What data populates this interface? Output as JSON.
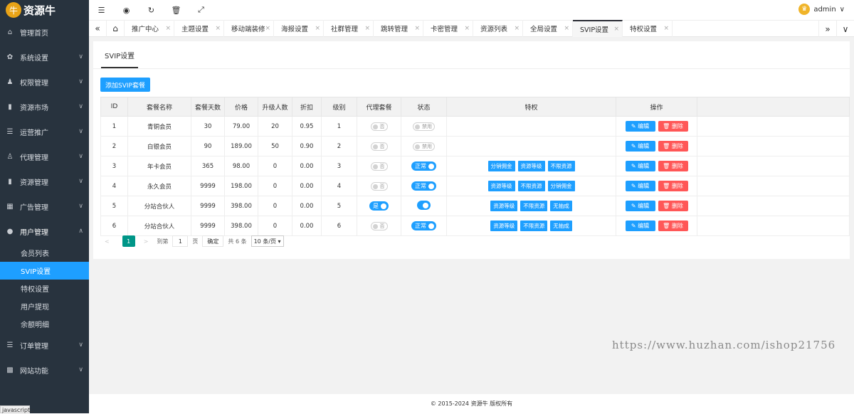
{
  "brand": {
    "logo_mark": "牛",
    "name": "资源牛"
  },
  "sidebar": {
    "items": [
      {
        "label": "管理首页",
        "icon": "home-icon",
        "glyph": "⌂",
        "chevron": ""
      },
      {
        "label": "系统设置",
        "icon": "gear-icon",
        "glyph": "✿",
        "chevron": "∨"
      },
      {
        "label": "权限管理",
        "icon": "user-key-icon",
        "glyph": "♟",
        "chevron": "∨"
      },
      {
        "label": "资源市场",
        "icon": "doc-icon",
        "glyph": "▮",
        "chevron": "∨"
      },
      {
        "label": "运营推广",
        "icon": "list-icon",
        "glyph": "☰",
        "chevron": "∨"
      },
      {
        "label": "代理管理",
        "icon": "agent-icon",
        "glyph": "♙",
        "chevron": "∨"
      },
      {
        "label": "资源管理",
        "icon": "doc-icon",
        "glyph": "▮",
        "chevron": "∨"
      },
      {
        "label": "广告管理",
        "icon": "ad-icon",
        "glyph": "▦",
        "chevron": "∨"
      },
      {
        "label": "用户管理",
        "icon": "user-icon",
        "glyph": "●",
        "chevron": "∧"
      }
    ],
    "sub_items": [
      "会员列表",
      "SVIP设置",
      "特权设置",
      "用户提现",
      "余额明细"
    ],
    "bottom_items": [
      {
        "label": "订单管理",
        "icon": "list-icon",
        "glyph": "☰",
        "chevron": "∨"
      },
      {
        "label": "网站功能",
        "icon": "grid-icon",
        "glyph": "▩",
        "chevron": "∨"
      }
    ],
    "status_tip": "javascript:;"
  },
  "topbar": {
    "icons": [
      "☰",
      "◉",
      "↻",
      "🗑",
      "⤢"
    ],
    "user": "admin",
    "user_chevron": "∨"
  },
  "tabs": {
    "prev": "«",
    "home": "⌂",
    "items": [
      "推广中心",
      "主题设置",
      "移动端装修",
      "海报设置",
      "社群管理",
      "跳转管理",
      "卡密管理",
      "资源列表",
      "全局设置",
      "SVIP设置",
      "特权设置"
    ],
    "close": "×",
    "next": "»",
    "more": "∨"
  },
  "page": {
    "tab_title": "SVIP设置",
    "add_button": "添加SVIP套餐"
  },
  "table": {
    "headers": [
      "ID",
      "套餐名称",
      "套餐天数",
      "价格",
      "升级人数",
      "折扣",
      "级别",
      "代理套餐",
      "状态",
      "特权",
      "操作"
    ],
    "edit_label": "✎ 编辑",
    "delete_label": "🗑 删除",
    "rows": [
      {
        "id": "1",
        "name": "青铜会员",
        "days": "30",
        "price": "79.00",
        "upgrade": "20",
        "discount": "0.95",
        "level": "1",
        "agent": "否",
        "status": "禁用",
        "status_on": false,
        "privileges": []
      },
      {
        "id": "2",
        "name": "白银会员",
        "days": "90",
        "price": "189.00",
        "upgrade": "50",
        "discount": "0.90",
        "level": "2",
        "agent": "否",
        "status": "禁用",
        "status_on": false,
        "privileges": []
      },
      {
        "id": "3",
        "name": "年卡会员",
        "days": "365",
        "price": "98.00",
        "upgrade": "0",
        "discount": "0.00",
        "level": "3",
        "agent": "否",
        "status": "正常",
        "status_on": true,
        "privileges": [
          "分销佣金",
          "资源等级",
          "不限资源"
        ]
      },
      {
        "id": "4",
        "name": "永久会员",
        "days": "9999",
        "price": "198.00",
        "upgrade": "0",
        "discount": "0.00",
        "level": "4",
        "agent": "否",
        "status": "正常",
        "status_on": true,
        "privileges": [
          "资源等级",
          "不限资源",
          "分销佣金"
        ]
      },
      {
        "id": "5",
        "name": "分站合伙人",
        "days": "9999",
        "price": "398.00",
        "upgrade": "0",
        "discount": "0.00",
        "level": "5",
        "agent": "是",
        "status": "",
        "status_on": true,
        "privileges": [
          "资源等级",
          "不限资源",
          "无抽成"
        ]
      },
      {
        "id": "6",
        "name": "分站合伙人",
        "days": "9999",
        "price": "398.00",
        "upgrade": "0",
        "discount": "0.00",
        "level": "6",
        "agent": "否",
        "status": "正常",
        "status_on": true,
        "privileges": [
          "资源等级",
          "不限资源",
          "无抽成"
        ]
      }
    ]
  },
  "pager": {
    "prev": "<",
    "current": "1",
    "next": ">",
    "goto": "到第",
    "page_value": "1",
    "page_unit": "页",
    "confirm": "确定",
    "total": "共 6 条",
    "per_page": "10 条/页 ▾"
  },
  "footer": "© 2015-2024 资源牛 版权所有",
  "watermark": "https://www.huzhan.com/ishop21756"
}
